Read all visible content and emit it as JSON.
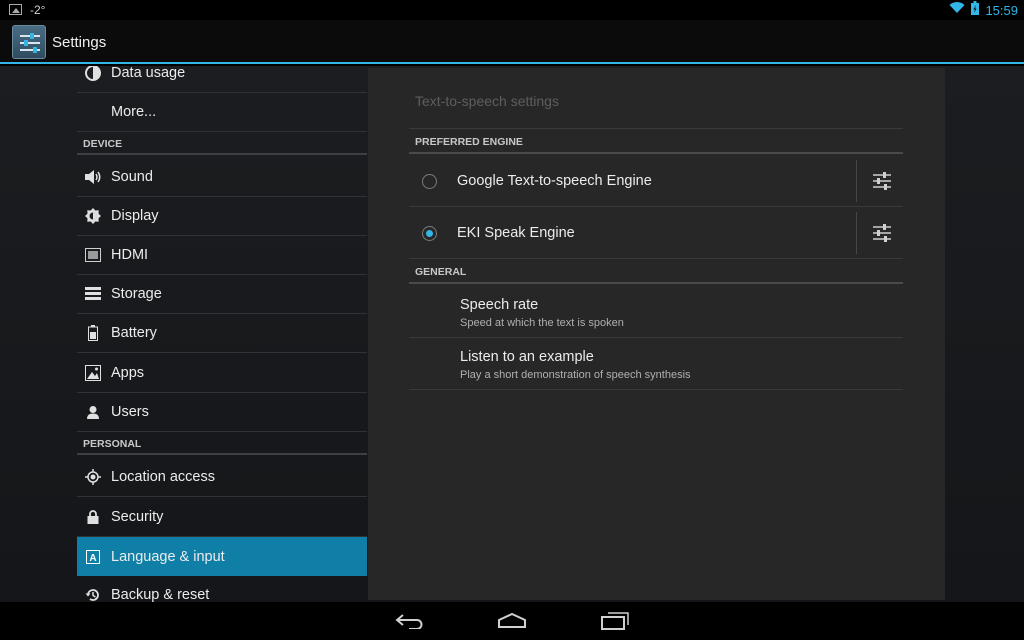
{
  "status_bar": {
    "temperature": "-2°",
    "time": "15:59",
    "icons": [
      "image-notification-icon",
      "wifi-icon",
      "battery-icon"
    ],
    "accent_color": "#33b5e5"
  },
  "action_bar": {
    "title": "Settings",
    "icon": "settings-app-icon"
  },
  "sidebar": {
    "top_items": [
      {
        "label": "Data usage",
        "icon": "data-usage-icon"
      },
      {
        "label": "More...",
        "icon": ""
      }
    ],
    "device_header": "DEVICE",
    "device_items": [
      {
        "label": "Sound",
        "icon": "sound-icon"
      },
      {
        "label": "Display",
        "icon": "display-icon"
      },
      {
        "label": "HDMI",
        "icon": "hdmi-icon"
      },
      {
        "label": "Storage",
        "icon": "storage-icon"
      },
      {
        "label": "Battery",
        "icon": "battery-icon"
      },
      {
        "label": "Apps",
        "icon": "apps-icon"
      },
      {
        "label": "Users",
        "icon": "users-icon"
      }
    ],
    "personal_header": "PERSONAL",
    "personal_items": [
      {
        "label": "Location access",
        "icon": "location-icon"
      },
      {
        "label": "Security",
        "icon": "lock-icon"
      },
      {
        "label": "Language & input",
        "icon": "language-icon",
        "selected": true
      },
      {
        "label": "Backup & reset",
        "icon": "backup-icon"
      }
    ],
    "selected_color": "#0f7fa8"
  },
  "panel": {
    "title": "Text-to-speech settings",
    "preferred_header": "PREFERRED ENGINE",
    "engines": [
      {
        "label": "Google Text-to-speech Engine",
        "selected": false
      },
      {
        "label": "EKI Speak Engine",
        "selected": true
      }
    ],
    "general_header": "GENERAL",
    "general_items": [
      {
        "title": "Speech rate",
        "summary": "Speed at which the text is spoken"
      },
      {
        "title": "Listen to an example",
        "summary": "Play a short demonstration of speech synthesis"
      }
    ]
  },
  "nav_bar": {
    "buttons": [
      "back-icon",
      "home-icon",
      "recent-apps-icon"
    ]
  }
}
